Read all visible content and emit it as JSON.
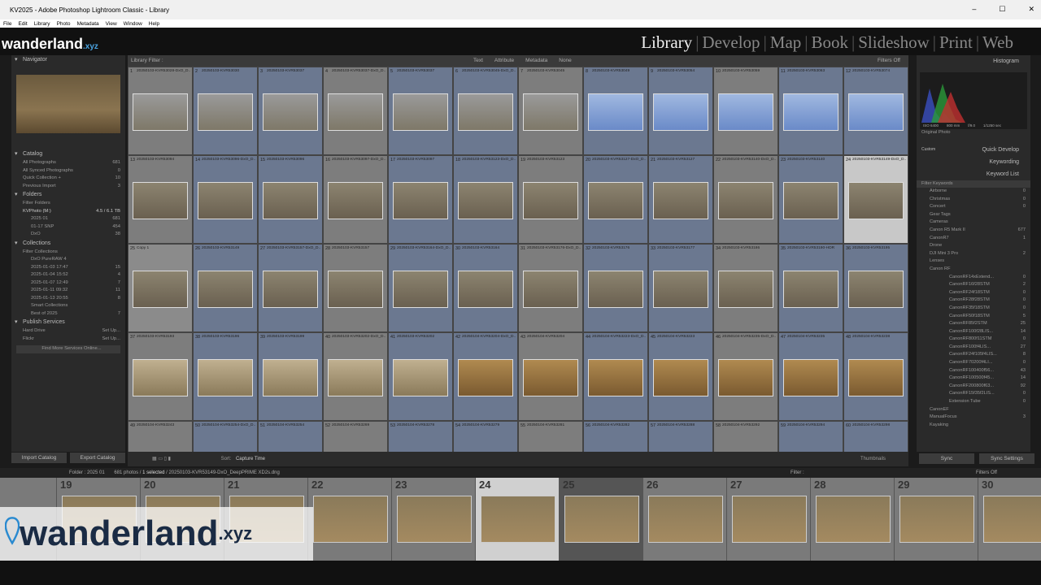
{
  "window": {
    "title": "KV2025 - Adobe Photoshop Lightroom Classic - Library"
  },
  "menu": [
    "File",
    "Edit",
    "Library",
    "Photo",
    "Metadata",
    "View",
    "Window",
    "Help"
  ],
  "brand": {
    "name": "wanderland",
    "tld": ".xyz"
  },
  "modules": [
    "Library",
    "Develop",
    "Map",
    "Book",
    "Slideshow",
    "Print",
    "Web"
  ],
  "left": {
    "navigator": "Navigator",
    "nav_zoom": [
      "Fit",
      "100%",
      "1:3.5"
    ],
    "catalog": "Catalog",
    "catalog_items": [
      [
        "All Photographs",
        "681"
      ],
      [
        "All Synced Photographs",
        "0"
      ],
      [
        "Quick Collection +",
        "10"
      ],
      [
        "Previous Import",
        "3"
      ]
    ],
    "folders": "Folders",
    "filter_folders": "Filter Folders",
    "drive": [
      "KVPhoto (M:)",
      "4.5 / 6.1 TB"
    ],
    "folder_items": [
      [
        "2025 01",
        "681"
      ],
      [
        "01-17 SNP",
        "454"
      ],
      [
        "DxO",
        "38"
      ]
    ],
    "collections": "Collections",
    "filter_collections": "Filter Collections",
    "collection_items": [
      [
        "DxO PureRAW 4",
        ""
      ],
      [
        "2025-01-03 17:47",
        "15"
      ],
      [
        "2025-01-04 15:52",
        "4"
      ],
      [
        "2025-01-07 12:49",
        "7"
      ],
      [
        "2025-01-11 09:32",
        "11"
      ],
      [
        "2025-01-13 20:55",
        "8"
      ],
      [
        "Smart Collections",
        ""
      ],
      [
        "Best of 2025",
        "7"
      ]
    ],
    "publish": "Publish Services",
    "publish_items": [
      [
        "Hard Drive",
        "Set Up..."
      ],
      [
        "Flickr",
        "Set Up..."
      ]
    ],
    "find_more": "Find More Services Online...",
    "import": "Import Catalog",
    "export": "Export Catalog"
  },
  "grid": {
    "filter_label": "Library Filter :",
    "filter_tabs": [
      "Text",
      "Attribute",
      "Metadata",
      "None"
    ],
    "filters_off": "Filters Off",
    "cells": [
      [
        "1",
        "20250103-KVR53028-DxO_D..."
      ],
      [
        "2",
        "20250103-KVR53030"
      ],
      [
        "3",
        "20250103-KVR53037"
      ],
      [
        "4",
        "20250103-KVR53037-DxO_D..."
      ],
      [
        "5",
        "20250103-KVR53037"
      ],
      [
        "6",
        "20250103-KVR53045-DxO_D..."
      ],
      [
        "7",
        "20250103-KVR53045"
      ],
      [
        "8",
        "20250103-KVR53049"
      ],
      [
        "9",
        "20250103-KVR53054"
      ],
      [
        "10",
        "20250103-KVR53059"
      ],
      [
        "11",
        "20250103-KVR53063"
      ],
      [
        "12",
        "20250103-KVR53074"
      ],
      [
        "13",
        "20250103-KVR53094"
      ],
      [
        "14",
        "20250103-KVR53096-DxO_D..."
      ],
      [
        "15",
        "20250103-KVR53096"
      ],
      [
        "16",
        "20250103-KVR53097-DxO_D..."
      ],
      [
        "17",
        "20250103-KVR53097"
      ],
      [
        "18",
        "20250103-KVR53123-DxO_D..."
      ],
      [
        "19",
        "20250103-KVR53123"
      ],
      [
        "20",
        "20250103-KVR53127-DxO_D..."
      ],
      [
        "21",
        "20250103-KVR53127"
      ],
      [
        "22",
        "20250103-KVR53140-DxO_D..."
      ],
      [
        "23",
        "20250103-KVR53140"
      ],
      [
        "24",
        "20250103-KVR53149-DxO_D..."
      ],
      [
        "25",
        "Copy 1"
      ],
      [
        "26",
        "20250103-KVR53149"
      ],
      [
        "27",
        "20250103-KVR53157-DxO_D..."
      ],
      [
        "28",
        "20250103-KVR53157"
      ],
      [
        "29",
        "20250103-KVR53164-DxO_D..."
      ],
      [
        "30",
        "20250103-KVR53164"
      ],
      [
        "31",
        "20250103-KVR53176-DxO_D..."
      ],
      [
        "32",
        "20250103-KVR53176"
      ],
      [
        "33",
        "20250103-KVR53177"
      ],
      [
        "34",
        "20250103-KVR53186"
      ],
      [
        "35",
        "20250103-KVR53190-HDR"
      ],
      [
        "36",
        "20250103-KVR53195"
      ],
      [
        "37",
        "20250103-KVR53193"
      ],
      [
        "38",
        "20250103-KVR53196"
      ],
      [
        "39",
        "20250103-KVR53199"
      ],
      [
        "40",
        "20250103-KVR53202-DxO_D..."
      ],
      [
        "41",
        "20250103-KVR53202"
      ],
      [
        "42",
        "20250104-KVR53204-DxO_D..."
      ],
      [
        "43",
        "20250104-KVR53204"
      ],
      [
        "44",
        "20250104-KVR53223-DxO_D..."
      ],
      [
        "45",
        "20250104-KVR53223"
      ],
      [
        "46",
        "20250104-KVR53235-DxO_D..."
      ],
      [
        "47",
        "20250104-KVR53235"
      ],
      [
        "48",
        "20250104-KVR53238"
      ],
      [
        "49",
        "20250104-KVR53243"
      ],
      [
        "50",
        "20250104-KVR53254-DxO_D..."
      ],
      [
        "51",
        "20250104-KVR53254"
      ],
      [
        "52",
        "20250104-KVR53269"
      ],
      [
        "53",
        "20250104-KVR53278"
      ],
      [
        "54",
        "20250104-KVR53279"
      ],
      [
        "55",
        "20250104-KVR53281"
      ],
      [
        "56",
        "20250104-KVR53282"
      ],
      [
        "57",
        "20250104-KVR53288"
      ],
      [
        "58",
        "20250104-KVR53292"
      ],
      [
        "59",
        "20250104-KVR53294"
      ],
      [
        "60",
        "20250104-KVR53298"
      ]
    ]
  },
  "toolbar": {
    "sort": "Sort:",
    "sort_value": "Capture Time",
    "thumbnails": "Thumbnails"
  },
  "right": {
    "histogram": "Histogram",
    "histo_info": [
      "ISO 6400",
      "800 mm",
      "f/9.0",
      "1/1250 sec"
    ],
    "original_photo": "Original Photo",
    "custom": "Custom",
    "quick_develop": "Quick Develop",
    "keywording": "Keywording",
    "keyword_list": "Keyword List",
    "filter_keywords": "Filter Keywords",
    "keywords": [
      [
        "Airborne",
        "0"
      ],
      [
        "Christmas",
        "0"
      ],
      [
        "Concert",
        "0"
      ],
      [
        "Gear Tags",
        ""
      ],
      [
        "Cameras",
        ""
      ],
      [
        "Canon R5 Mark II",
        "677"
      ],
      [
        "CanonR7",
        "1"
      ],
      [
        "Drone",
        ""
      ],
      [
        "DJI Mini 3 Pro",
        "2"
      ],
      [
        "Lenses",
        ""
      ],
      [
        "Canon RF",
        ""
      ],
      [
        "CanonRF14xExtend...",
        "0"
      ],
      [
        "CanonRF16f28STM",
        "2"
      ],
      [
        "CanonRF24f18STM",
        "0"
      ],
      [
        "CanonRF28f28STM",
        "0"
      ],
      [
        "CanonRF35f18STM",
        "0"
      ],
      [
        "CanonRF50f18STM",
        "5"
      ],
      [
        "CanonRF85f2STM",
        "25"
      ],
      [
        "CanonRF100f28LIS...",
        "14"
      ],
      [
        "CanonRF800f11STM",
        "0"
      ],
      [
        "CanonRF100f4LIS...",
        "27"
      ],
      [
        "CanonRF24f105f4LIS...",
        "8"
      ],
      [
        "CanonRF70200f4LI...",
        "0"
      ],
      [
        "CanonRF100400f56...",
        "43"
      ],
      [
        "CanonRF100500f45...",
        "14"
      ],
      [
        "CanonRF200800f63...",
        "92"
      ],
      [
        "CanonRF15f35f2LIS...",
        "0"
      ],
      [
        "Extension Tube",
        "0"
      ],
      [
        "CanonEF",
        ""
      ],
      [
        "ManualFocus",
        "3"
      ],
      [
        "Kayaking",
        ""
      ]
    ],
    "sync": "Sync",
    "sync_settings": "Sync Settings"
  },
  "filmbar": {
    "folder": "Folder : 2025 01",
    "count": "681 photos /",
    "selected": "1 selected",
    "path": "/ 20250103-KVR53149-DxO_DeepPRIME XD2s.dng",
    "filter": "Filter :",
    "filters_off": "Filters Off"
  },
  "filmstrip": [
    "19",
    "20",
    "21",
    "22",
    "23",
    "24",
    "25",
    "26",
    "27",
    "28",
    "29",
    "30"
  ]
}
